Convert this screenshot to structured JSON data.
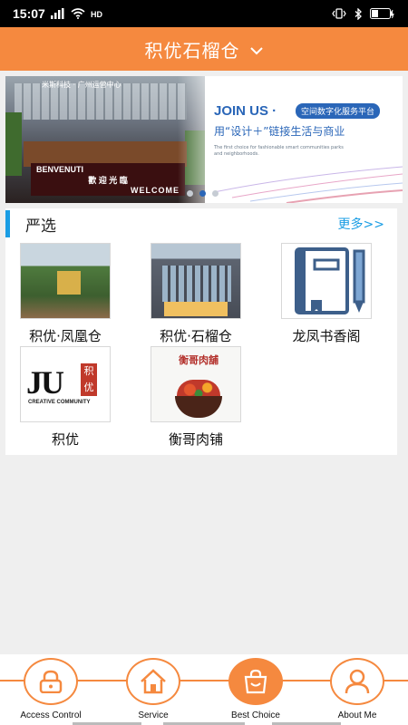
{
  "status_bar": {
    "time": "15:07",
    "battery_level": 0.35
  },
  "header": {
    "title": "积优石榴仓"
  },
  "banner": {
    "photo_caption": "米斯科技 · 广州运营中心",
    "sign_line1": "BENVENUTI",
    "sign_line2": "歡 迎 光 臨",
    "sign_line3": "WELCOME",
    "join_us": "JOIN US ·",
    "pill": "空间数字化服务平台",
    "tagline": "用“设计＋”链接生活与商业",
    "small_text": "The first choice for fashionable smart communities parks and neighborhoods.",
    "slides": 3,
    "active_slide": 1
  },
  "section": {
    "title": "严选",
    "more_label": "更多>>",
    "items": [
      {
        "label": "积优·凤凰仓",
        "art": "building-photo"
      },
      {
        "label": "积优·石榴仓",
        "art": "building-photo"
      },
      {
        "label": "龙凤书香阁",
        "art": "book-icon"
      },
      {
        "label": "积优",
        "art": "ju-logo",
        "logo_text": "JU",
        "logo_badge": "积优",
        "logo_sub": "CREATIVE COMMUNITY"
      },
      {
        "label": "衡哥肉铺",
        "art": "food-photo",
        "art_title": "衡哥肉舖"
      }
    ]
  },
  "tabs": [
    {
      "label": "Access Control",
      "icon": "lock-icon",
      "active": false
    },
    {
      "label": "Service",
      "icon": "home-icon",
      "active": false
    },
    {
      "label": "Best Choice",
      "icon": "shopping-bag-icon",
      "active": true
    },
    {
      "label": "About Me",
      "icon": "person-icon",
      "active": false
    }
  ],
  "colors": {
    "brand": "#f5893f",
    "accent": "#1a9de4",
    "banner_blue": "#2a66b8"
  }
}
